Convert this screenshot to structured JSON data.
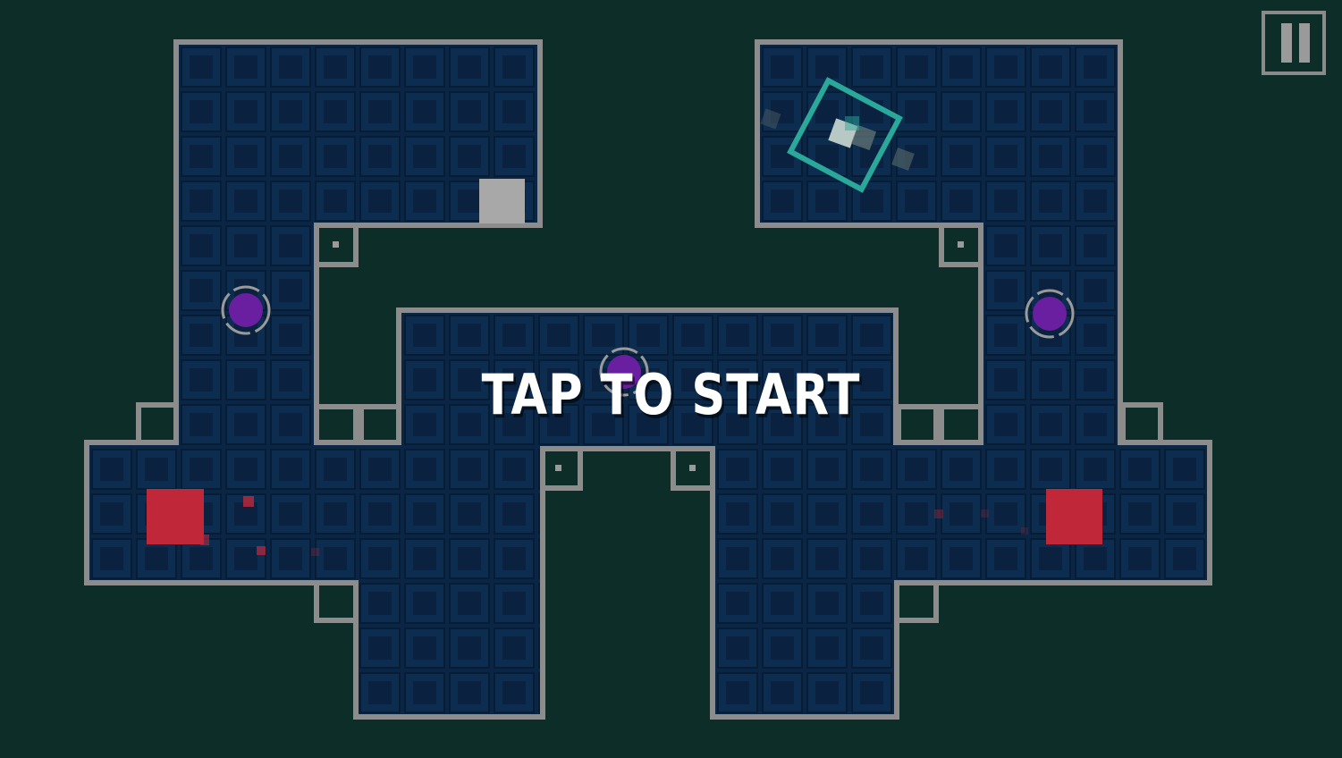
{
  "overlay": {
    "prompt": "TAP TO START"
  },
  "hud": {
    "pause_icon": "pause-icon"
  },
  "colors": {
    "background": "#0d2e28",
    "floor": "#0a2646",
    "wall": "#8c8c8c",
    "orb": "#6a1fa0",
    "hazard": "#c0283a",
    "player": "#2aa89a",
    "goal_block": "#a8a8a8"
  },
  "entities": {
    "purple_orbs": 3,
    "red_blocks": 2,
    "grey_blocks": 1,
    "player": 1
  }
}
